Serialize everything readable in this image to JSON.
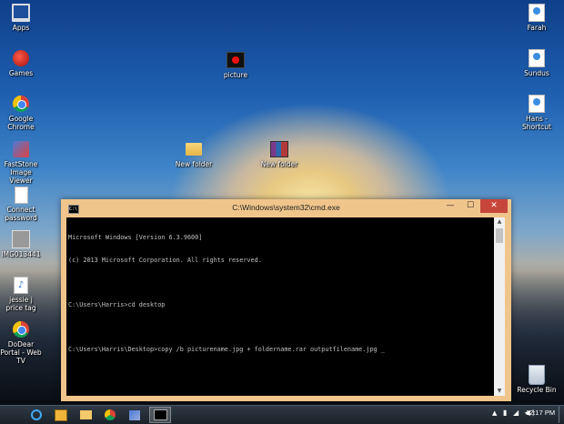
{
  "desktop": {
    "icons_left": [
      {
        "label": "Apps",
        "icon": "apps-icon"
      },
      {
        "label": "Games",
        "icon": "games-icon"
      },
      {
        "label": "Google Chrome",
        "icon": "chrome-icon"
      },
      {
        "label": "FastStone Image Viewer",
        "icon": "faststone-icon"
      },
      {
        "label": "Connect password",
        "icon": "document-icon"
      },
      {
        "label": "IMG013441",
        "icon": "image-file-icon"
      },
      {
        "label": "jessie j price tag",
        "icon": "audio-file-icon"
      },
      {
        "label": "DoDear Portal - Web TV",
        "icon": "chrome-icon"
      }
    ],
    "icons_mid": [
      {
        "label": "picture",
        "icon": "picture-icon"
      },
      {
        "label": "New folder",
        "icon": "folder-icon"
      },
      {
        "label": "New folder",
        "icon": "rar-archive-icon"
      }
    ],
    "icons_right": [
      {
        "label": "Farah",
        "icon": "user-folder-icon"
      },
      {
        "label": "Sundus",
        "icon": "user-folder-icon"
      },
      {
        "label": "Hans - Shortcut",
        "icon": "shortcut-icon"
      },
      {
        "label": "Recycle Bin",
        "icon": "recycle-bin-icon"
      }
    ]
  },
  "cmd_window": {
    "title": "C:\\Windows\\system32\\cmd.exe",
    "sys_icon_text": "C:\\",
    "minimize": "—",
    "maximize": "☐",
    "close": "✕",
    "lines": [
      "Microsoft Windows [Version 6.3.9600]",
      "(c) 2013 Microsoft Corporation. All rights reserved.",
      "",
      "C:\\Users\\Harris>cd desktop",
      "",
      "C:\\Users\\Harris\\Desktop>copy /b picturename.jpg + foldername.rar outputfilename.jpg"
    ],
    "cursor": "_",
    "scroll_up": "▲",
    "scroll_down": "▼"
  },
  "taskbar": {
    "apps": [
      {
        "name": "internet-explorer-icon",
        "active": false
      },
      {
        "name": "media-player-icon",
        "active": false
      },
      {
        "name": "file-explorer-icon",
        "active": false
      },
      {
        "name": "chrome-icon",
        "active": false
      },
      {
        "name": "photo-viewer-icon",
        "active": false
      },
      {
        "name": "cmd-icon",
        "active": true
      }
    ],
    "tray_arrow": "▲",
    "tray_icons": "▮ ◢ ◀)",
    "time": "12:17 PM"
  }
}
